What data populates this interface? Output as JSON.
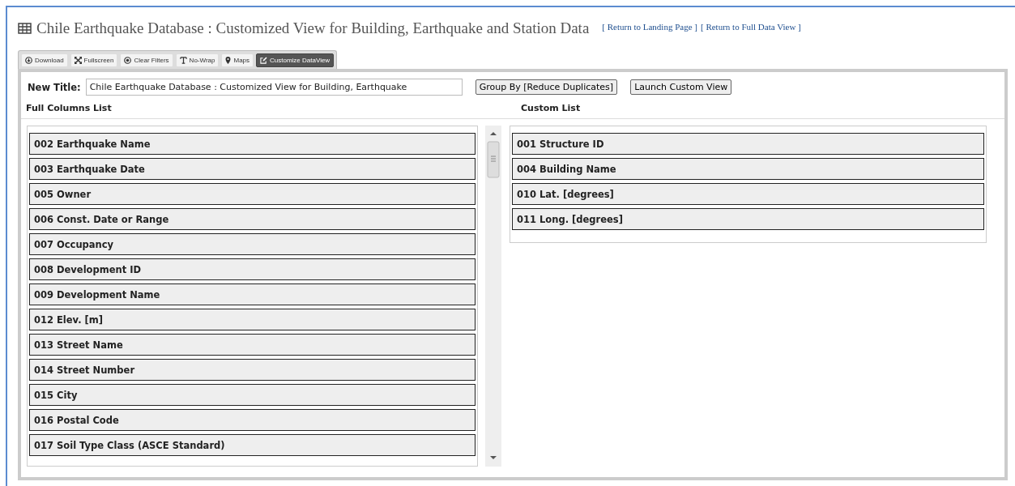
{
  "page_title": "Chile Earthquake Database : Customized View for Building, Earthquake and Station Data",
  "links": [
    "[ Return to Landing Page ]",
    "[ Return to Full Data View ]"
  ],
  "tabs": [
    {
      "label": "Download",
      "selected": false
    },
    {
      "label": "Fullscreen",
      "selected": false
    },
    {
      "label": "Clear Filters",
      "selected": false
    },
    {
      "label": "No-Wrap",
      "selected": false
    },
    {
      "label": "Maps",
      "selected": false
    },
    {
      "label": "Customize DataView",
      "selected": true
    }
  ],
  "form": {
    "label": "New Title:",
    "value": "Chile Earthquake Database : Customized View for Building, Earthquake",
    "buttons": [
      "Group By [Reduce Duplicates]",
      "Launch Custom View"
    ]
  },
  "full_columns": {
    "heading": "Full Columns List",
    "items": [
      "002 Earthquake Name",
      "003 Earthquake Date",
      "005 Owner",
      "006 Const. Date or Range",
      "007 Occupancy",
      "008 Development ID",
      "009 Development Name",
      "012 Elev. [m]",
      "013 Street Name",
      "014 Street Number",
      "015 City",
      "016 Postal Code",
      "017 Soil Type Class (ASCE Standard)"
    ]
  },
  "custom_list": {
    "heading": "Custom List",
    "items": [
      "001 Structure ID",
      "004 Building Name",
      "010 Lat. [degrees]",
      "011 Long. [degrees]"
    ]
  }
}
